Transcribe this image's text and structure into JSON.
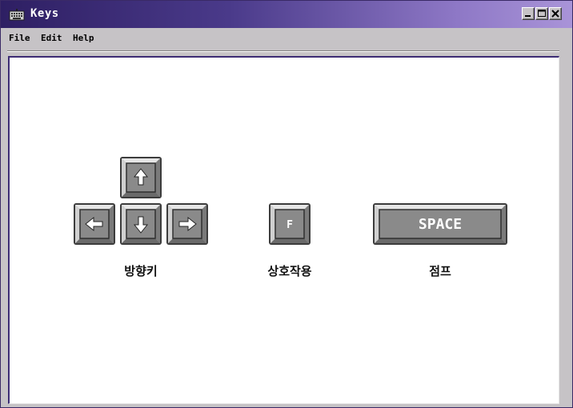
{
  "window": {
    "title": "Keys",
    "icon": "keyboard-icon",
    "controls": [
      "minimize-icon",
      "maximize-icon",
      "close-icon"
    ]
  },
  "menu": [
    {
      "label": "File"
    },
    {
      "label": "Edit"
    },
    {
      "label": "Help"
    }
  ],
  "groups": {
    "arrows": {
      "label": "방향키",
      "keys": [
        "up-arrow-icon",
        "left-arrow-icon",
        "down-arrow-icon",
        "right-arrow-icon"
      ]
    },
    "interact": {
      "label": "상호작용",
      "key": "F"
    },
    "jump": {
      "label": "점프",
      "key": "SPACE"
    }
  },
  "colors": {
    "titlebar_start": "#2e1f63",
    "titlebar_end": "#a994d8",
    "key_face": "#8a8a8a",
    "key_dark": "#3c3c3c",
    "key_light": "#c8c8c8"
  }
}
